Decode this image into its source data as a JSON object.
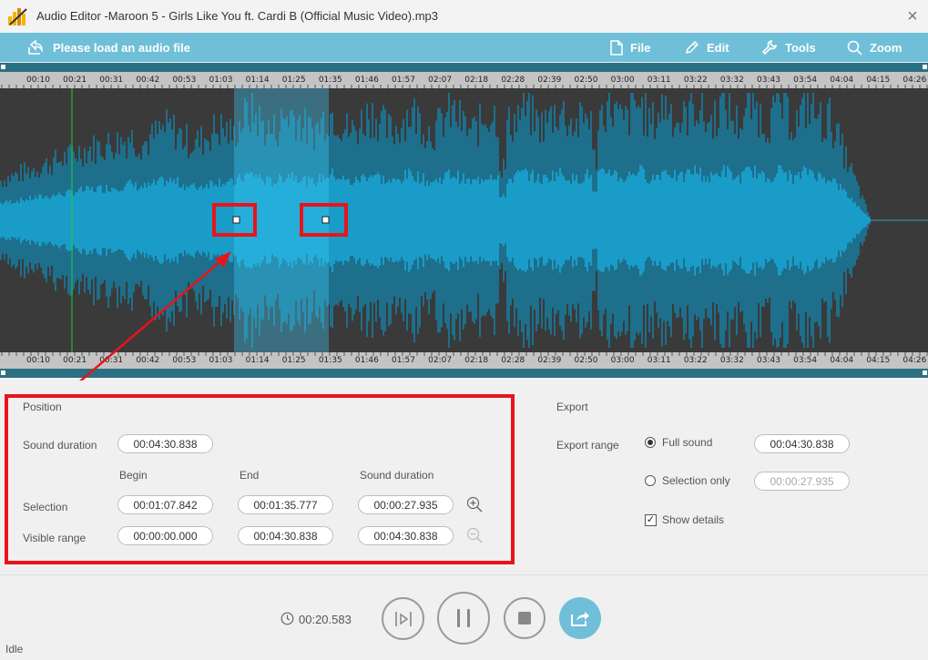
{
  "window": {
    "app_name": "Audio Editor",
    "file_title": "-Maroon 5 - Girls Like You ft. Cardi B (Official Music Video).mp3",
    "close_icon": "close-icon"
  },
  "toolbar": {
    "load_label": "Please load an audio file",
    "file_label": "File",
    "edit_label": "Edit",
    "tools_label": "Tools",
    "zoom_label": "Zoom",
    "bg_color": "#6fbfd8"
  },
  "timeline": {
    "ticks": [
      "00:10",
      "00:21",
      "00:31",
      "00:42",
      "00:53",
      "01:03",
      "01:14",
      "01:25",
      "01:35",
      "01:46",
      "01:57",
      "02:07",
      "02:18",
      "02:28",
      "02:39",
      "02:50",
      "03:00",
      "03:11",
      "03:22",
      "03:32",
      "03:43",
      "03:54",
      "04:04",
      "04:15",
      "04:26"
    ],
    "selection_start": "01:07",
    "selection_end": "01:35",
    "playhead": "00:20",
    "wave_color": "#1a9cc8",
    "selection_color": "#29c0e8"
  },
  "position": {
    "title": "Position",
    "sound_duration_label": "Sound duration",
    "sound_duration_value": "00:04:30.838",
    "col_begin": "Begin",
    "col_end": "End",
    "col_duration": "Sound duration",
    "selection_label": "Selection",
    "selection_begin": "00:01:07.842",
    "selection_end": "00:01:35.777",
    "selection_duration": "00:00:27.935",
    "visible_label": "Visible range",
    "visible_begin": "00:00:00.000",
    "visible_end": "00:04:30.838",
    "visible_duration": "00:04:30.838"
  },
  "export": {
    "title": "Export",
    "range_label": "Export range",
    "full_sound_label": "Full sound",
    "full_sound_value": "00:04:30.838",
    "selection_only_label": "Selection only",
    "selection_only_value": "00:00:27.935",
    "show_details_label": "Show details",
    "mode": "full_sound"
  },
  "player": {
    "current_time": "00:20.583",
    "status": "Idle"
  },
  "highlight_color": "#e8141b"
}
